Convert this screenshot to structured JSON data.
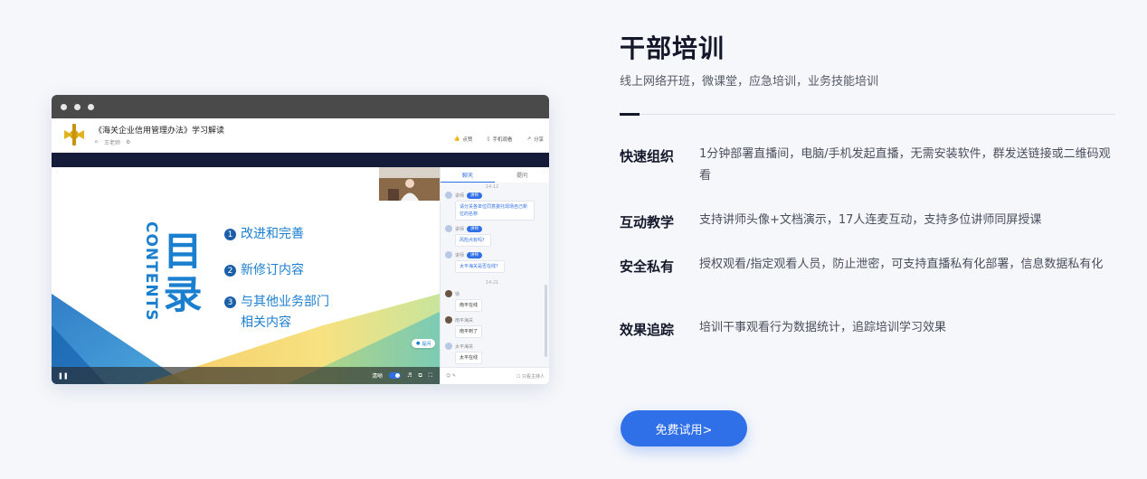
{
  "mock": {
    "course_title": "《海关企业信用管理办法》学习解读",
    "teacher": "王老师",
    "actions": {
      "like": "点赞",
      "mobile": "手机观看",
      "share": "分享"
    },
    "slide": {
      "contents_word": "CONTENTS",
      "mulu": "目录",
      "items": [
        {
          "num": "1",
          "label": "改进和完善"
        },
        {
          "num": "2",
          "label": "新修订内容"
        },
        {
          "num": "3",
          "label": "与其他业务部门",
          "sub": "相关内容"
        }
      ],
      "speech_chip": "提问"
    },
    "player": {
      "clarity": "清晰"
    },
    "chat": {
      "tabs": [
        "聊天",
        "提问"
      ],
      "time1": "14:12",
      "time2": "14:21",
      "messages": [
        {
          "user": "讲师",
          "tag": "讲师",
          "text": "请分关各单位同意委托现场自己新位的名称"
        },
        {
          "user": "讲师",
          "tag": "讲师",
          "text": "风险点有吗？"
        },
        {
          "user": "讲师",
          "tag": "讲师",
          "text": "太平海关是否在线？"
        },
        {
          "user": "徐",
          "text": "南平在线"
        },
        {
          "user": "南平海关",
          "text": "南平到了"
        },
        {
          "user": "太平海关",
          "text": "太平在线"
        }
      ],
      "footer_right": "只看主持人"
    }
  },
  "section": {
    "title": "干部培训",
    "subtitle": "线上网络开班，微课堂，应急培训，业务技能培训",
    "features": [
      {
        "name": "快速组织",
        "desc": "1分钟部署直播间，电脑/手机发起直播，无需安装软件，群发送链接或二维码观看"
      },
      {
        "name": "互动教学",
        "desc": "支持讲师头像+文档演示，17人连麦互动，支持多位讲师同屏授课"
      },
      {
        "name": "安全私有",
        "desc": "授权观看/指定观看人员，防止泄密，可支持直播私有化部署，信息数据私有化"
      },
      {
        "name": "效果追踪",
        "desc": "培训干事观看行为数据统计，追踪培训学习效果"
      }
    ],
    "cta": "免费试用>"
  },
  "colors": {
    "accent": "#2f6fe8",
    "heading": "#14182a",
    "slide_blue": "#1b7fd0"
  }
}
